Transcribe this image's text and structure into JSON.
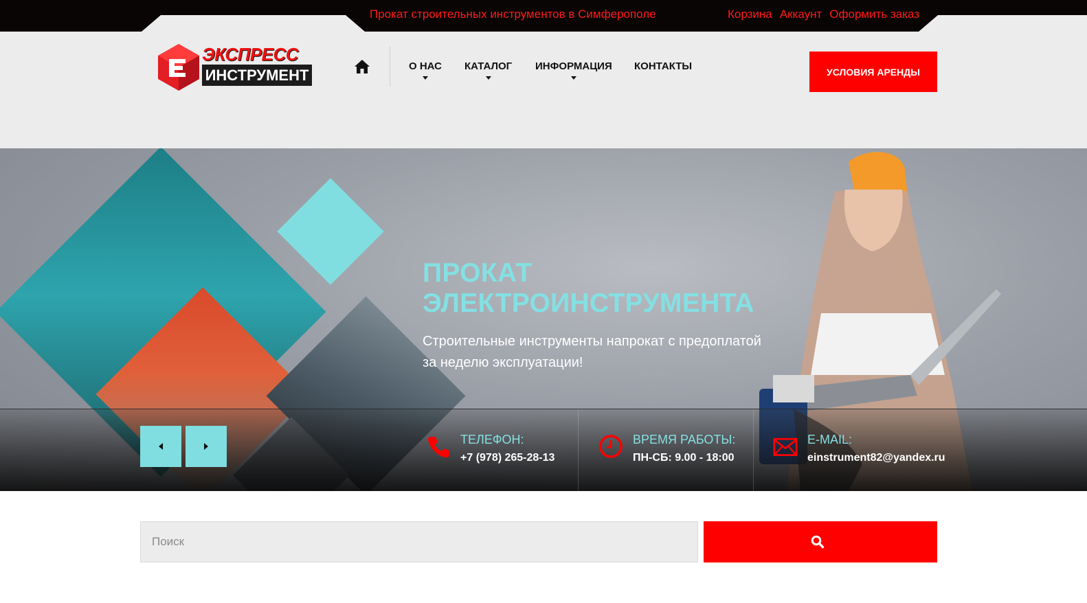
{
  "topbar": {
    "tagline": "Прокат строительных инструментов в Симферополе",
    "links": [
      "Корзина",
      "Аккаунт",
      "Оформить заказ"
    ]
  },
  "logo": {
    "line1": "ЭКСПРЕСС",
    "line2": "ИНСТРУМЕНТ"
  },
  "nav": {
    "home_icon": "home-icon",
    "items": [
      "О НАС",
      "КАТАЛОГ",
      "ИНФОРМАЦИЯ",
      "КОНТАКТЫ"
    ]
  },
  "header": {
    "rent_button": "УСЛОВИЯ АРЕНДЫ"
  },
  "hero": {
    "title_line1": "ПРОКАТ",
    "title_line2": "ЭЛЕКТРОИНСТРУМЕНТА",
    "subtitle_line1": "Строительные инструменты напрокат с предоплатой",
    "subtitle_line2": "за неделю эксплуатации!"
  },
  "contacts": {
    "phone_label": "ТЕЛЕФОН:",
    "phone_value": "+7 (978) 265-28-13",
    "hours_label": "ВРЕМЯ РАБОТЫ:",
    "hours_value": "ПН-СБ: 9.00 - 18:00",
    "email_label": "E-MAIL:",
    "email_value": "einstrument82@yandex.ru"
  },
  "search": {
    "placeholder": "Поиск"
  },
  "colors": {
    "accent_red": "#ff0000",
    "accent_cyan": "#80dde0",
    "topbar_bg": "#0a0505",
    "header_bg": "#ececec"
  }
}
